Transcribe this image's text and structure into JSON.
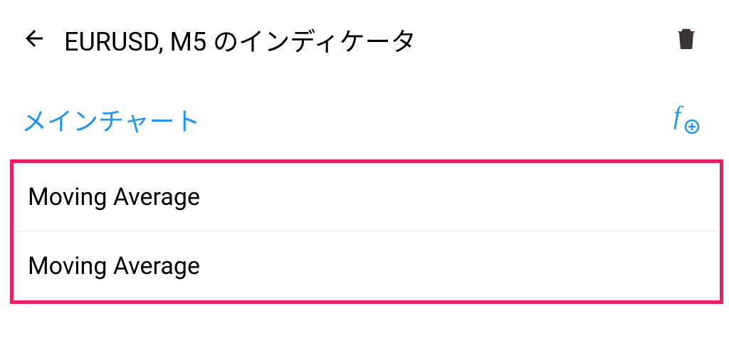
{
  "header": {
    "title": "EURUSD, M5 のインディケータ"
  },
  "section": {
    "title": "メインチャート"
  },
  "indicators": [
    {
      "name": "Moving Average"
    },
    {
      "name": "Moving Average"
    }
  ]
}
